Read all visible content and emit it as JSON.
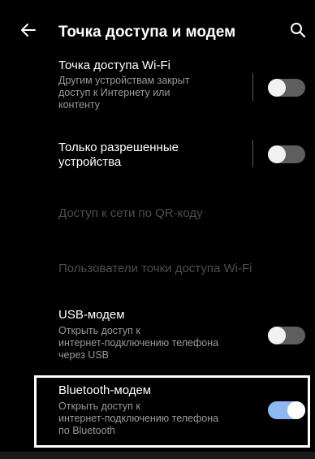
{
  "header": {
    "title": "Точка доступа и модем",
    "back_icon": "back-arrow-icon",
    "search_icon": "search-icon"
  },
  "items": {
    "wifi_hotspot": {
      "title": "Точка доступа Wi-Fi",
      "subtitle_lines": [
        "Другим устройствам закрыт",
        "доступ к Интернету или",
        "контенту"
      ],
      "toggle_on": false
    },
    "allowed_devices": {
      "title_lines": [
        "Только разрешенные",
        "устройства"
      ],
      "toggle_on": false
    },
    "qr_access": {
      "title": "Доступ к сети по QR-коду"
    },
    "hotspot_users": {
      "title": "Пользователи точки доступа Wi-Fi"
    },
    "usb_modem": {
      "title": "USB-модем",
      "subtitle_lines": [
        "Открыть доступ к",
        "интернет-подключению телефона",
        "через USB"
      ],
      "toggle_on": false
    },
    "bluetooth_modem": {
      "title": "Bluetooth-модем",
      "subtitle_lines": [
        "Открыть доступ к",
        "интернет-подключению телефона",
        "по Bluetooth"
      ],
      "toggle_on": true
    }
  },
  "colors": {
    "background": "#000000",
    "toggle_on": "#8fb8f2",
    "toggle_off": "#5e5e5e",
    "secondary_text": "#9a9a9a",
    "disabled_text": "#4d4d4d"
  }
}
